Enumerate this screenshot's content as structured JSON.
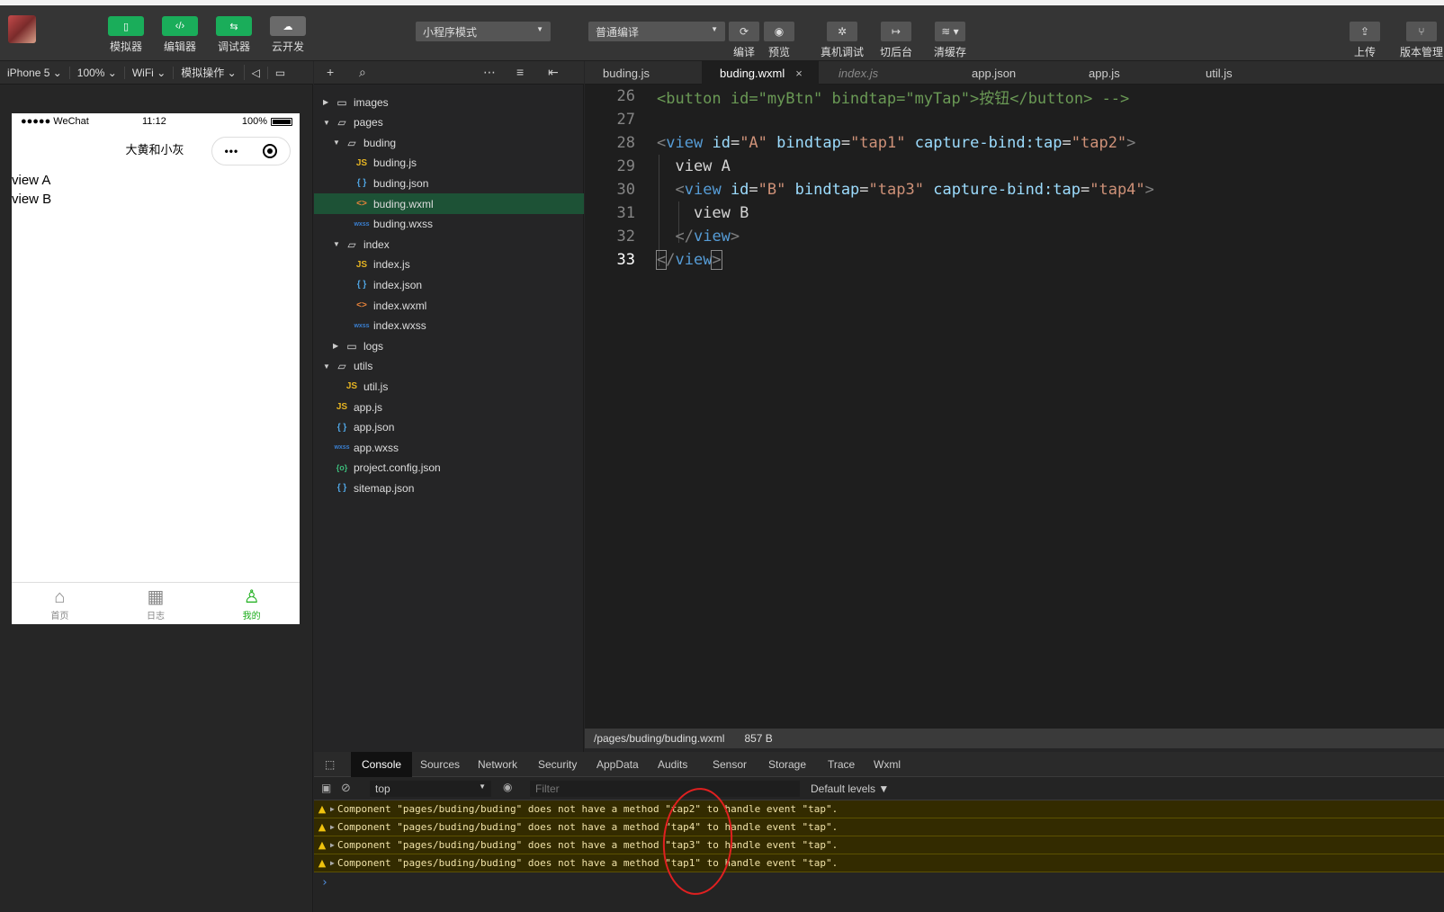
{
  "toolbar": {
    "buttons": [
      {
        "label": "模拟器"
      },
      {
        "label": "编辑器"
      },
      {
        "label": "调试器"
      },
      {
        "label": "云开发"
      }
    ],
    "mode_select": "小程序模式",
    "compile_select": "普通编译",
    "actions": [
      {
        "label": "编译"
      },
      {
        "label": "预览"
      },
      {
        "label": "真机调试"
      },
      {
        "label": "切后台"
      },
      {
        "label": "清缓存"
      },
      {
        "label": "上传"
      },
      {
        "label": "版本管理"
      }
    ]
  },
  "sim_bar": {
    "device": "iPhone 5",
    "zoom": "100%",
    "network": "WiFi",
    "ops": "模拟操作"
  },
  "phone": {
    "carrier": "●●●●● WeChat",
    "time": "11:12",
    "battery": "100%",
    "title": "大黄和小灰",
    "lines": [
      "view A",
      "view B"
    ],
    "tabs": [
      {
        "label": "首页",
        "icon": "home-icon"
      },
      {
        "label": "日志",
        "icon": "calendar-icon"
      },
      {
        "label": "我的",
        "icon": "user-icon"
      }
    ]
  },
  "tree": [
    {
      "name": "images",
      "type": "folder",
      "expanded": false,
      "depth": 0
    },
    {
      "name": "pages",
      "type": "folder",
      "expanded": true,
      "depth": 0
    },
    {
      "name": "buding",
      "type": "folder",
      "expanded": true,
      "depth": 1
    },
    {
      "name": "buding.js",
      "type": "js",
      "depth": 2
    },
    {
      "name": "buding.json",
      "type": "json",
      "depth": 2
    },
    {
      "name": "buding.wxml",
      "type": "wxml",
      "depth": 2,
      "selected": true
    },
    {
      "name": "buding.wxss",
      "type": "wxss",
      "depth": 2
    },
    {
      "name": "index",
      "type": "folder",
      "expanded": true,
      "depth": 1
    },
    {
      "name": "index.js",
      "type": "js",
      "depth": 2
    },
    {
      "name": "index.json",
      "type": "json",
      "depth": 2
    },
    {
      "name": "index.wxml",
      "type": "wxml",
      "depth": 2
    },
    {
      "name": "index.wxss",
      "type": "wxss",
      "depth": 2
    },
    {
      "name": "logs",
      "type": "folder",
      "expanded": false,
      "depth": 1
    },
    {
      "name": "utils",
      "type": "folder",
      "expanded": true,
      "depth": 0
    },
    {
      "name": "util.js",
      "type": "js",
      "depth": 1
    },
    {
      "name": "app.js",
      "type": "js",
      "depth": 0
    },
    {
      "name": "app.json",
      "type": "json",
      "depth": 0
    },
    {
      "name": "app.wxss",
      "type": "wxss",
      "depth": 0
    },
    {
      "name": "project.config.json",
      "type": "cfg",
      "depth": 0
    },
    {
      "name": "sitemap.json",
      "type": "json",
      "depth": 0
    }
  ],
  "editor_tabs": [
    {
      "label": "buding.js"
    },
    {
      "label": "buding.wxml",
      "close": "×"
    },
    {
      "label": "index.js"
    },
    {
      "label": "app.json"
    },
    {
      "label": "app.js"
    },
    {
      "label": "util.js"
    }
  ],
  "code": {
    "lines": [
      "26",
      "27",
      "28",
      "29",
      "30",
      "31",
      "32",
      "33"
    ]
  },
  "status": {
    "path": "/pages/buding/buding.wxml",
    "size": "857 B"
  },
  "devtools": {
    "tabs": [
      "Console",
      "Sources",
      "Network",
      "Security",
      "AppData",
      "Audits",
      "Sensor",
      "Storage",
      "Trace",
      "Wxml"
    ],
    "context": "top",
    "filter_placeholder": "Filter",
    "levels": "Default levels ▼",
    "warnings": [
      "Component \"pages/buding/buding\" does not have a method \"tap2\" to handle event \"tap\".",
      "Component \"pages/buding/buding\" does not have a method \"tap4\" to handle event \"tap\".",
      "Component \"pages/buding/buding\" does not have a method \"tap3\" to handle event \"tap\".",
      "Component \"pages/buding/buding\" does not have a method \"tap1\" to handle event \"tap\"."
    ],
    "prompt": "›"
  },
  "colors": {
    "accent_green": "#1aad5a",
    "selected_file": "#1d5236",
    "warning_bg": "#332b00",
    "annotation": "#e02020"
  }
}
